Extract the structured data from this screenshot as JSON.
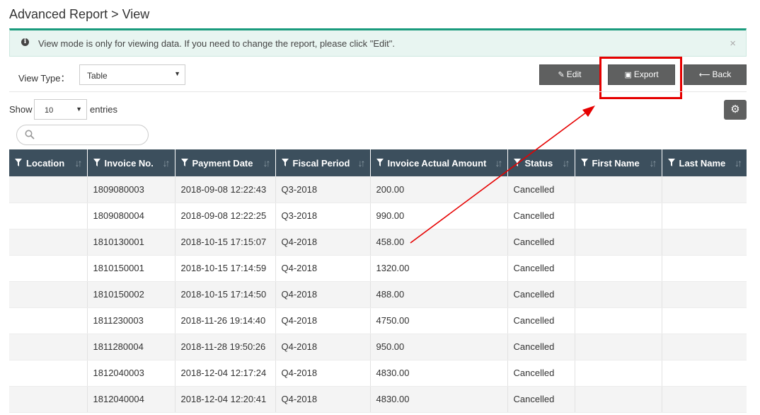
{
  "header": {
    "title": "Advanced Report > View"
  },
  "alert": {
    "icon": "info-circle-icon",
    "message": "View mode is only for viewing data. If you need to change the report, please click \"Edit\".",
    "close_glyph": "×"
  },
  "view_type": {
    "label": "View Type：",
    "selected": "Table"
  },
  "toolbar": {
    "edit_label": "Edit",
    "export_label": "Export",
    "back_label": "Back"
  },
  "entries": {
    "show_label": "Show",
    "selected": "10",
    "suffix_label": "entries"
  },
  "search": {
    "placeholder": "",
    "value": ""
  },
  "annotation": {
    "highlight_color": "#e60000"
  },
  "table": {
    "columns": [
      "Location",
      "Invoice No.",
      "Payment Date",
      "Fiscal Period",
      "Invoice Actual Amount",
      "Status",
      "First Name",
      "Last Name"
    ],
    "rows": [
      [
        "",
        "1809080003",
        "2018-09-08 12:22:43",
        "Q3-2018",
        "200.00",
        "Cancelled",
        "",
        ""
      ],
      [
        "",
        "1809080004",
        "2018-09-08 12:22:25",
        "Q3-2018",
        "990.00",
        "Cancelled",
        "",
        ""
      ],
      [
        "",
        "1810130001",
        "2018-10-15 17:15:07",
        "Q4-2018",
        "458.00",
        "Cancelled",
        "",
        ""
      ],
      [
        "",
        "1810150001",
        "2018-10-15 17:14:59",
        "Q4-2018",
        "1320.00",
        "Cancelled",
        "",
        ""
      ],
      [
        "",
        "1810150002",
        "2018-10-15 17:14:50",
        "Q4-2018",
        "488.00",
        "Cancelled",
        "",
        ""
      ],
      [
        "",
        "1811230003",
        "2018-11-26 19:14:40",
        "Q4-2018",
        "4750.00",
        "Cancelled",
        "",
        ""
      ],
      [
        "",
        "1811280004",
        "2018-11-28 19:50:26",
        "Q4-2018",
        "950.00",
        "Cancelled",
        "",
        ""
      ],
      [
        "",
        "1812040003",
        "2018-12-04 12:17:24",
        "Q4-2018",
        "4830.00",
        "Cancelled",
        "",
        ""
      ],
      [
        "",
        "1812040004",
        "2018-12-04 12:20:41",
        "Q4-2018",
        "4830.00",
        "Cancelled",
        "",
        ""
      ]
    ]
  }
}
